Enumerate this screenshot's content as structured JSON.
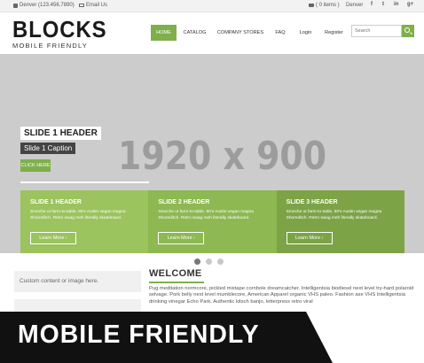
{
  "topbar": {
    "phone": "Denver (123.456.7890)",
    "email": "Email Us",
    "cart": "( 0 items )",
    "location": "Denver",
    "social_icons": [
      "facebook-icon",
      "twitter-icon",
      "linkedin-icon",
      "googleplus-icon"
    ],
    "social_glyphs": [
      "f",
      "t",
      "in",
      "g+"
    ]
  },
  "logo": {
    "wordmark": "BLOCKS",
    "tagline": "MOBILE FRIENDLY"
  },
  "nav": {
    "items": [
      {
        "label": "HOME",
        "active": true
      },
      {
        "label": "CATALOG",
        "active": false
      },
      {
        "label": "COMPANY STORES",
        "active": false
      },
      {
        "label": "FAQ",
        "active": false
      },
      {
        "label": "Login",
        "active": false
      },
      {
        "label": "Register",
        "active": false
      }
    ]
  },
  "search": {
    "placeholder": "Search"
  },
  "slider": {
    "placeholder_text": "1920 x 900",
    "header": "SLIDE 1 HEADER",
    "caption": "Slide 1 Caption",
    "cta": "CLICK HERE",
    "panels": [
      {
        "header": "SLIDE 1 HEADER",
        "text": "Smeche ut farm-to-table, 90's Austin vegan magna Shoreditch. Retro swag meh literally skateboard.",
        "button": "Learn More ›",
        "color": "#9bc35e"
      },
      {
        "header": "SLIDE 2 HEADER",
        "text": "Smeche ut farm-to-table, 90's Austin vegan magna Shoreditch. Retro swag meh literally skateboard.",
        "button": "Learn More ›",
        "color": "#8db852"
      },
      {
        "header": "SLIDE 3 HEADER",
        "text": "Smeche ut farm-to-table, 90's Austin vegan magna Shoreditch. Retro swag meh literally skateboard.",
        "button": "Learn More ›",
        "color": "#7da347"
      }
    ],
    "active_dot": 0,
    "dot_count": 3
  },
  "content": {
    "sidebar_box": "Custom content or image here.",
    "welcome_title": "WELCOME",
    "welcome_text": "Pug meditation normcore, pickled mixtape cornhole dreamcatcher. Intelligentsia biodiesel next level try-hard polaroid selvage. Pork belly next level mumblecore, American Apparel organic VHS paleo. Fashion axe VHS Intelligentsia drinking vinegar Echo Park. Authentic kitsch banjo, letterpress retro viral"
  },
  "banner": {
    "text": "MOBILE FRIENDLY"
  },
  "colors": {
    "accent": "#7faf4b",
    "slider_bg": "#cccccc",
    "banner_bg": "#111111"
  }
}
